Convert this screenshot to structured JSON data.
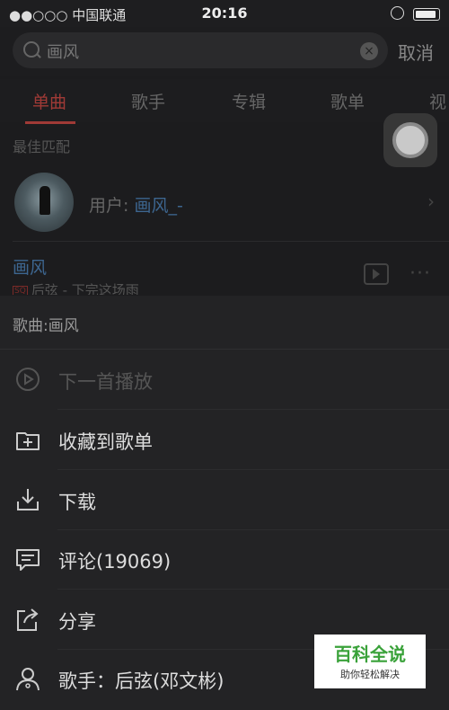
{
  "status_bar": {
    "carrier": "●●○○○ 中国联通",
    "time": "20:16"
  },
  "search": {
    "query": "画风",
    "cancel_label": "取消"
  },
  "tabs": [
    {
      "label": "单曲",
      "active": true
    },
    {
      "label": "歌手"
    },
    {
      "label": "专辑"
    },
    {
      "label": "歌单"
    },
    {
      "label": "视"
    }
  ],
  "best_match": {
    "section_label": "最佳匹配",
    "user_prefix": "用户: ",
    "user_name": "画风_-"
  },
  "song_result": {
    "title": "画风",
    "quality_badge": "SQ",
    "subtitle": "后弦 - 下完这场雨"
  },
  "action_sheet": {
    "title": "歌曲:画风",
    "options": [
      {
        "label": "下一首播放",
        "icon": "play-next-icon",
        "disabled": true
      },
      {
        "label": "收藏到歌单",
        "icon": "add-to-playlist-icon"
      },
      {
        "label": "下载",
        "icon": "download-icon"
      },
      {
        "label": "评论(19069)",
        "icon": "comment-icon"
      },
      {
        "label": "分享",
        "icon": "share-icon"
      },
      {
        "label": "歌手：后弦(邓文彬)",
        "icon": "artist-icon"
      }
    ]
  },
  "watermark": {
    "title": "百科全说",
    "subtitle": "助你轻松解决"
  },
  "colors": {
    "accent": "#a03a36",
    "link": "#3d6690",
    "sheet_bg": "#232325"
  }
}
